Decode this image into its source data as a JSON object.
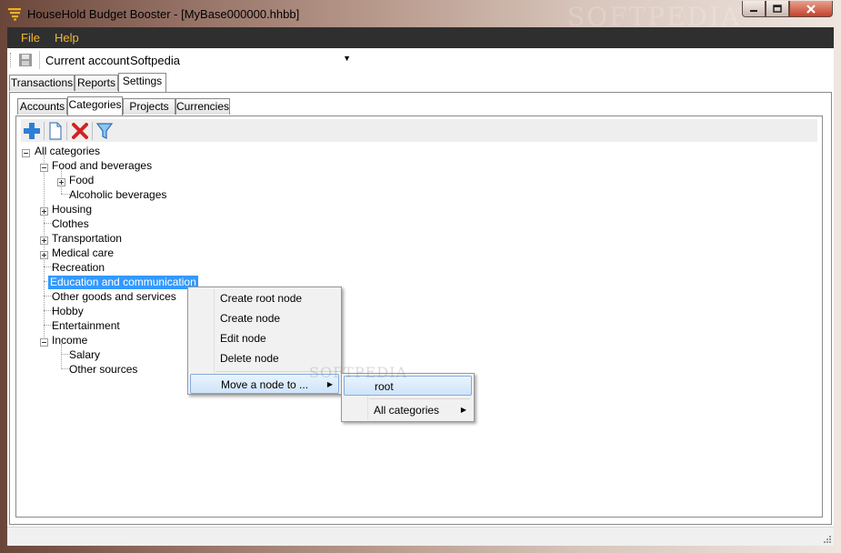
{
  "window": {
    "title": "HouseHold Budget Booster - [MyBase000000.hhbb]",
    "watermark": "SOFTPEDIA"
  },
  "menu": {
    "file": "File",
    "help": "Help"
  },
  "toolbar": {
    "account_label": "Current account",
    "account_value": "Softpedia"
  },
  "tabs": {
    "main": [
      "Transactions",
      "Reports",
      "Settings"
    ],
    "settings": [
      "Accounts",
      "Categories",
      "Projects",
      "Currencies"
    ]
  },
  "tree": {
    "root": "All categories",
    "food": "Food and beverages",
    "food_child": "Food",
    "alcohol": "Alcoholic beverages",
    "housing": "Housing",
    "clothes": "Clothes",
    "transportation": "Transportation",
    "medical": "Medical care",
    "recreation": "Recreation",
    "education": "Education and communication",
    "other_goods": "Other goods and services",
    "hobby": "Hobby",
    "entertainment": "Entertainment",
    "income": "Income",
    "salary": "Salary",
    "other_sources": "Other sources"
  },
  "context_menu": {
    "create_root": "Create root node",
    "create_node": "Create node",
    "edit_node": "Edit node",
    "delete_node": "Delete node",
    "move_node": "Move a node to ..."
  },
  "submenu": {
    "root": "root",
    "all_categories": "All categories"
  },
  "colors": {
    "menubar_bg": "#2f2f2f",
    "menu_text": "#f0b830",
    "selection": "#3399ff"
  }
}
